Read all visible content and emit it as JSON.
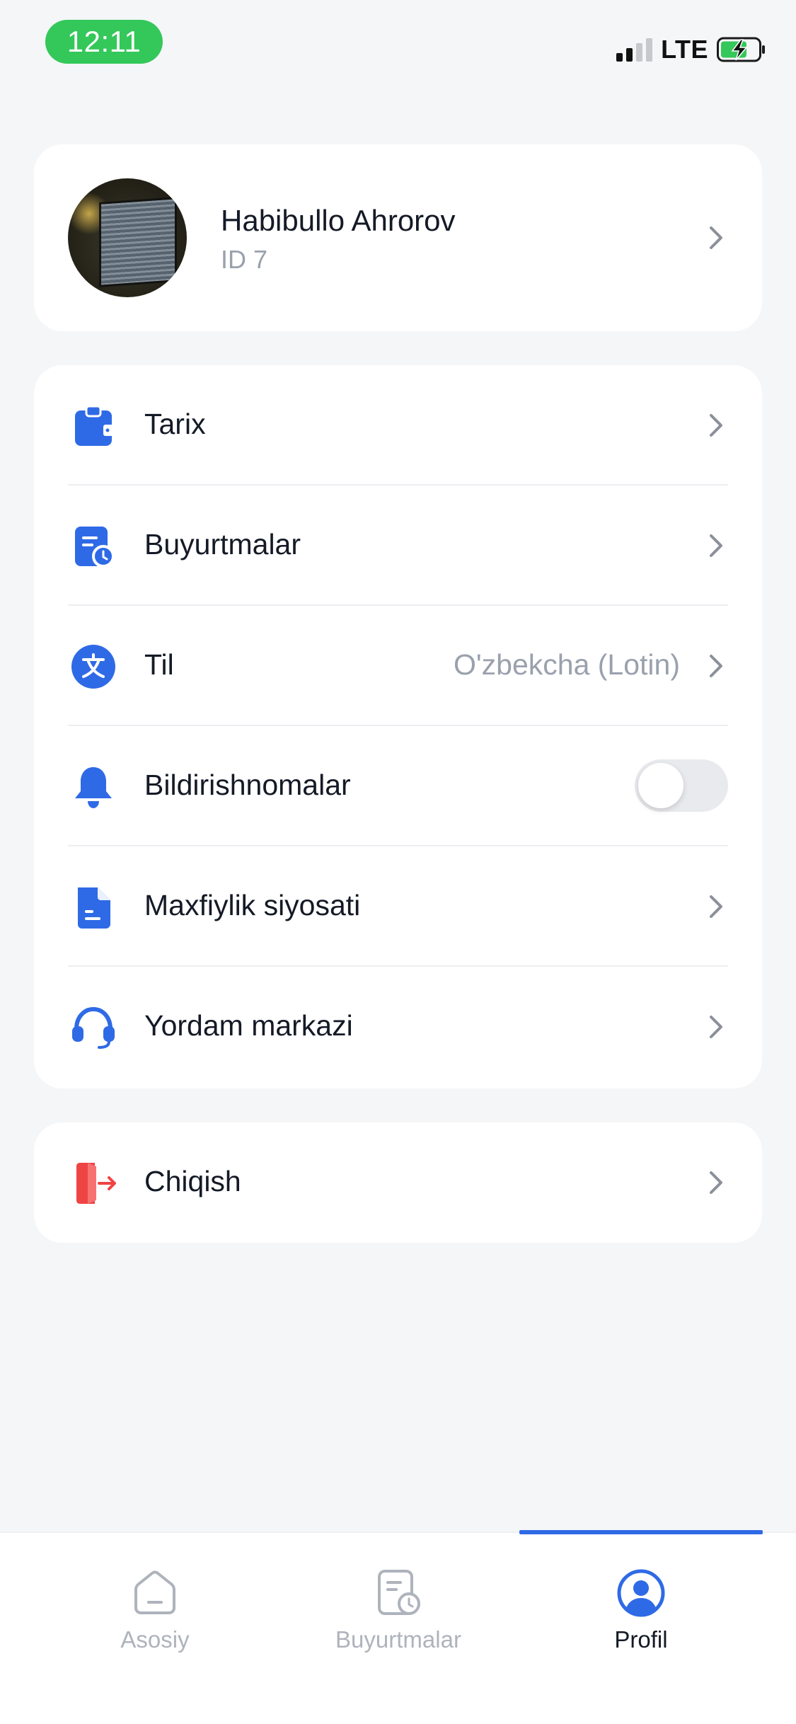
{
  "status_bar": {
    "time": "12:11",
    "network": "LTE",
    "signal_bars_active": 2,
    "signal_bars_total": 4,
    "battery_charging": true,
    "accent": "#34c759"
  },
  "profile": {
    "name": "Habibullo Ahrorov",
    "id_label": "ID 7"
  },
  "menu": {
    "items": [
      {
        "label": "Tarix",
        "icon": "clipboard-icon"
      },
      {
        "label": "Buyurtmalar",
        "icon": "order-history-icon"
      },
      {
        "label": "Til",
        "value": "O'zbekcha (Lotin)",
        "icon": "translate-icon"
      },
      {
        "label": "Bildirishnomalar",
        "icon": "bell-icon",
        "toggle_on": false
      },
      {
        "label": "Maxfiylik siyosati",
        "icon": "document-icon"
      },
      {
        "label": "Yordam markazi",
        "icon": "headset-icon"
      }
    ]
  },
  "logout": {
    "label": "Chiqish",
    "icon": "logout-icon",
    "color": "#ef4444"
  },
  "tabbar": {
    "tabs": [
      {
        "label": "Asosiy",
        "icon": "home-icon",
        "active": false
      },
      {
        "label": "Buyurtmalar",
        "icon": "orders-icon",
        "active": false
      },
      {
        "label": "Profil",
        "icon": "user-icon",
        "active": true
      }
    ],
    "accent": "#2f6ae6"
  },
  "colors": {
    "primary": "#2f6ae6",
    "background": "#f5f6f8",
    "secondary_text": "#9aa1ad"
  }
}
